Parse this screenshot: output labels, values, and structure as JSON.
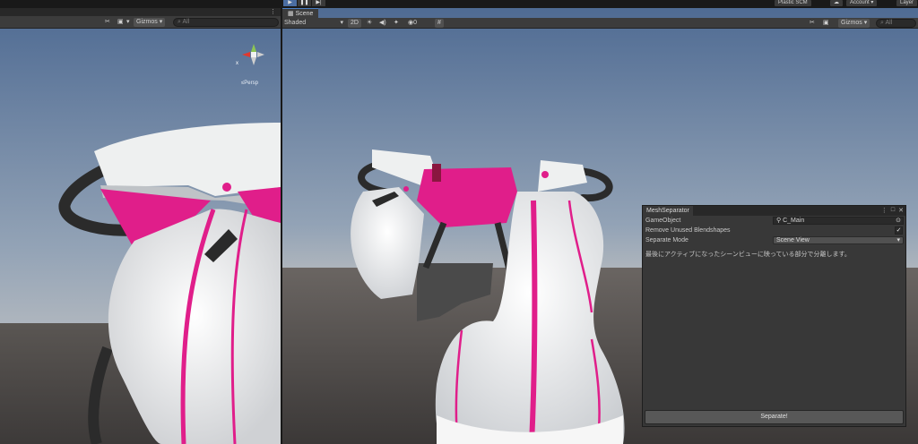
{
  "topbar": {
    "play_icon": "▶",
    "pause_icon": "❚❚",
    "step_icon": "▶|",
    "plastic_scm": "Plastic SCM",
    "cloud_icon": "☁",
    "account": "Account",
    "account_caret": "▾",
    "layers": "Layer"
  },
  "left_view": {
    "tools_icon": "✂",
    "camera_icon": "▣",
    "camera_caret": "▾",
    "gizmos": "Gizmos",
    "gizmos_caret": "▾",
    "search_placeholder": "All",
    "menu_dots": "⋮",
    "gizmo_x": "x",
    "gizmo_persp": "Persp"
  },
  "scene_view": {
    "tab": "Scene",
    "shading_mode": "Shaded",
    "shading_caret": "▾",
    "mode_2d": "2D",
    "light_icon": "☀",
    "audio_icon": "◀)",
    "fx_icon": "✦",
    "hidden_label": "0",
    "grid_icon": "#",
    "tools_icon": "✂",
    "camera_icon": "▣",
    "gizmos": "Gizmos",
    "gizmos_caret": "▾",
    "search_placeholder": "All",
    "menu_dots": "⋮"
  },
  "mesh_separator": {
    "title": "MeshSeparator",
    "menu_dots": "⋮",
    "maximize_icon": "□",
    "close_icon": "✕",
    "game_object_label": "GameObject",
    "game_object_value": "C_Main",
    "target_icon": "⊙",
    "remove_blendshapes_label": "Remove Unused Blendshapes",
    "remove_blendshapes_checked": "✓",
    "separate_mode_label": "Separate Mode",
    "separate_mode_value": "Scene View",
    "select_caret": "▾",
    "description": "最後にアクティブになったシーンビューに映っている部分で分離します。",
    "separate_button": "Separate!"
  },
  "colors": {
    "sky_top": "#4e6a93",
    "sky_bottom": "#aab6c4",
    "ground": "#4b4745",
    "garment_white": "#eceeee",
    "accent_pink": "#e01e8a",
    "strap_dark": "#2c2c2c",
    "panel_bg": "#383838"
  }
}
